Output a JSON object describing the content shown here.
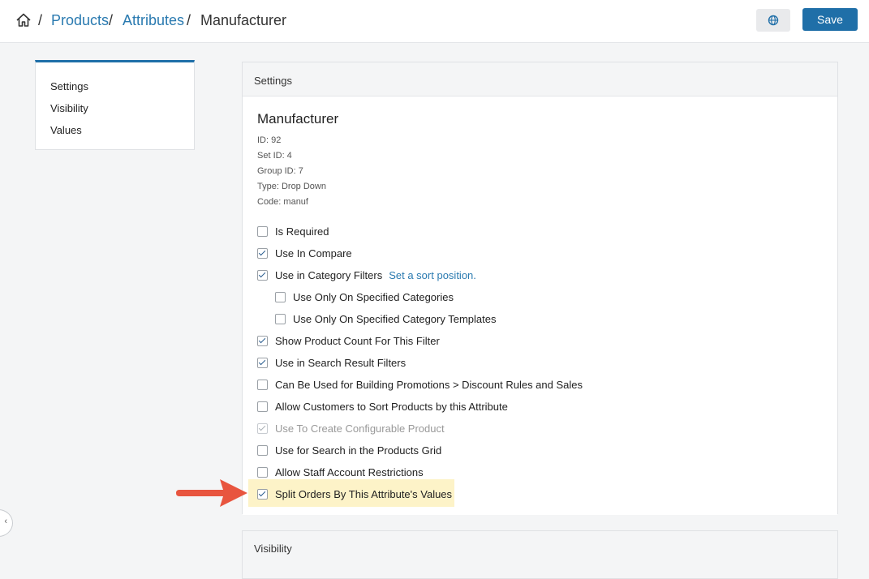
{
  "breadcrumb": {
    "items": [
      "Products",
      "Attributes"
    ],
    "current": "Manufacturer",
    "separator": "/"
  },
  "header": {
    "save_label": "Save",
    "globe_icon": "globe-icon"
  },
  "sidebar": {
    "items": [
      {
        "label": "Settings"
      },
      {
        "label": "Visibility"
      },
      {
        "label": "Values"
      }
    ]
  },
  "settings": {
    "title": "Settings",
    "attribute_name": "Manufacturer",
    "meta": [
      "ID: 92",
      "Set ID: 4",
      "Group ID: 7",
      "Type: Drop Down",
      "Code: manuf"
    ],
    "options": [
      {
        "label": "Is Required",
        "checked": false
      },
      {
        "label": "Use In Compare",
        "checked": true
      },
      {
        "label": "Use in Category Filters",
        "checked": true,
        "link": "Set a sort position."
      },
      {
        "label": "Use Only On Specified Categories",
        "checked": false
      },
      {
        "label": "Use Only On Specified Category Templates",
        "checked": false
      },
      {
        "label": "Show Product Count For This Filter",
        "checked": true
      },
      {
        "label": "Use in Search Result Filters",
        "checked": true
      },
      {
        "label": "Can Be Used for Building Promotions > Discount Rules and Sales",
        "checked": false
      },
      {
        "label": "Allow Customers to Sort Products by this Attribute",
        "checked": false
      },
      {
        "label": "Use To Create Configurable Product",
        "checked": true,
        "disabled": true
      },
      {
        "label": "Use for Search in the Products Grid",
        "checked": false
      },
      {
        "label": "Allow Staff Account Restrictions",
        "checked": false
      },
      {
        "label": "Split Orders By This Attribute's Values",
        "checked": true,
        "highlighted": true
      }
    ]
  },
  "visibility": {
    "title": "Visibility"
  },
  "colors": {
    "accent": "#1f6fa8",
    "link": "#2a7ab0",
    "highlight": "#fdf3c8",
    "arrow": "#e8553f"
  }
}
